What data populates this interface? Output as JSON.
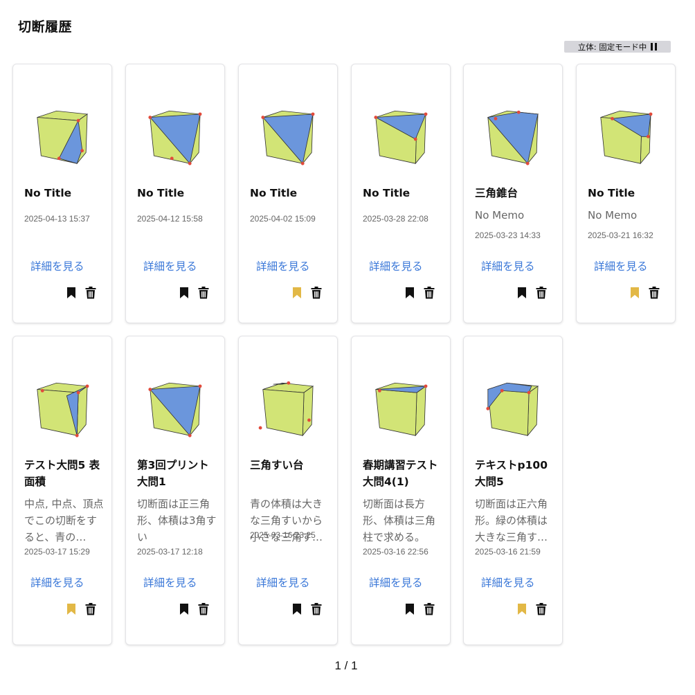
{
  "page": {
    "title": "切断履歴",
    "mode_label": "立体: 固定モード中",
    "mode_icon": "pause-icon",
    "pagination": "1 / 1"
  },
  "colors": {
    "cube_face": "#d2e476",
    "cut_face": "#6b96dc",
    "point": "#e24a3b",
    "link": "#3b78d8",
    "bookmark_active": "#e2b846",
    "bookmark_inactive": "#111111"
  },
  "cards": [
    {
      "title": "No Title",
      "memo": "",
      "date": "2025-04-13 15:37",
      "detail": "詳細を見る",
      "bookmarked": false
    },
    {
      "title": "No Title",
      "memo": "",
      "date": "2025-04-12 15:58",
      "detail": "詳細を見る",
      "bookmarked": false
    },
    {
      "title": "No Title",
      "memo": "",
      "date": "2025-04-02 15:09",
      "detail": "詳細を見る",
      "bookmarked": true
    },
    {
      "title": "No Title",
      "memo": "",
      "date": "2025-03-28 22:08",
      "detail": "詳細を見る",
      "bookmarked": false
    },
    {
      "title": "三角錐台",
      "memo": "No Memo",
      "date": "2025-03-23 14:33",
      "detail": "詳細を見る",
      "bookmarked": false
    },
    {
      "title": "No Title",
      "memo": "No Memo",
      "date": "2025-03-21 16:32",
      "detail": "詳細を見る",
      "bookmarked": true
    },
    {
      "title": "テスト大問5 表面積",
      "memo": "中点, 中点、頂点でこの切断をすると、青の…",
      "date": "2025-03-17 15:29",
      "detail": "詳細を見る",
      "bookmarked": true
    },
    {
      "title": "第3回プリント大問1",
      "memo": "切断面は正三角形、体積は3角すい",
      "date": "2025-03-17 12:18",
      "detail": "詳細を見る",
      "bookmarked": false
    },
    {
      "title": "三角すい台",
      "memo": "青の体積は大きな三角すいから小さな三角す…",
      "date": "2025-03-16 23:25",
      "detail": "詳細を見る",
      "bookmarked": false
    },
    {
      "title": "春期講習テスト大問4(1)",
      "memo": "切断面は長方形、体積は三角柱で求める。",
      "date": "2025-03-16 22:56",
      "detail": "詳細を見る",
      "bookmarked": false
    },
    {
      "title": "テキストp100大問5",
      "memo": "切断面は正六角形。緑の体積は大きな三角す…",
      "date": "2025-03-16 21:59",
      "detail": "詳細を見る",
      "bookmarked": true
    }
  ]
}
